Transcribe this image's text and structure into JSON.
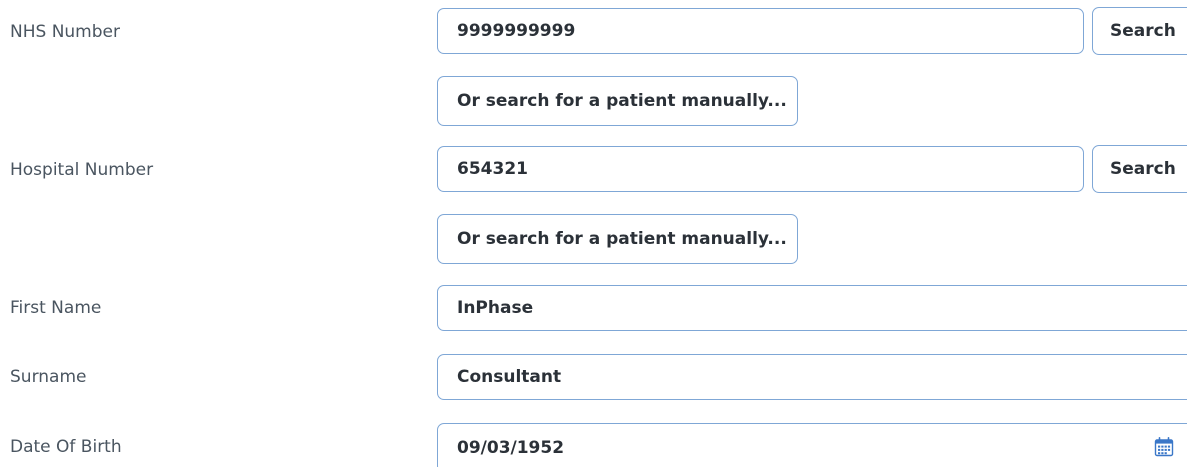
{
  "form": {
    "nhs_number": {
      "label": "NHS Number",
      "value": "9999999999",
      "search_label": "Search",
      "manual_label": "Or search for a patient manually..."
    },
    "hospital_number": {
      "label": "Hospital Number",
      "value": "654321",
      "search_label": "Search",
      "manual_label": "Or search for a patient manually..."
    },
    "first_name": {
      "label": "First Name",
      "value": "InPhase"
    },
    "surname": {
      "label": "Surname",
      "value": "Consultant"
    },
    "date_of_birth": {
      "label": "Date Of Birth",
      "value": "09/03/1952",
      "icon": "calendar-icon"
    }
  },
  "colors": {
    "border": "#7fa7d6",
    "label_text": "#4a5560",
    "value_text": "#2b3138",
    "calendar_icon": "#3a77c8"
  }
}
